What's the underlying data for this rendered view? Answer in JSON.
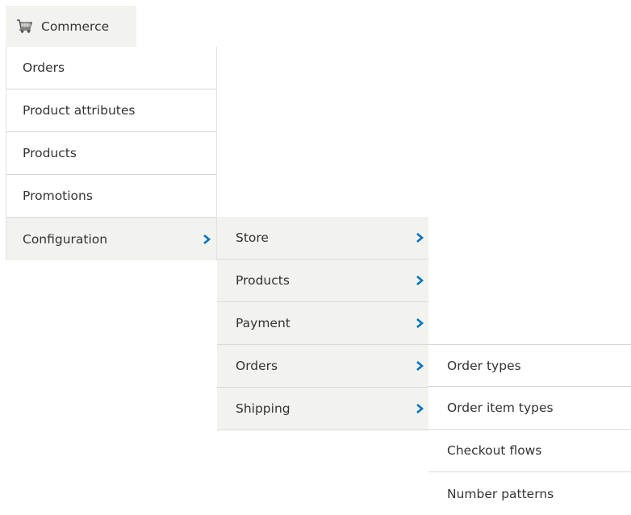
{
  "top_tab": {
    "icon": "shopping-cart-icon",
    "label": "Commerce"
  },
  "menu_level1": [
    {
      "label": "Orders"
    },
    {
      "label": "Product attributes"
    },
    {
      "label": "Products"
    },
    {
      "label": "Promotions"
    },
    {
      "label": "Configuration",
      "has_submenu": true,
      "active": true
    }
  ],
  "menu_level2": [
    {
      "label": "Store",
      "has_submenu": true
    },
    {
      "label": "Products",
      "has_submenu": true
    },
    {
      "label": "Payment",
      "has_submenu": true
    },
    {
      "label": "Orders",
      "has_submenu": true,
      "active": true
    },
    {
      "label": "Shipping",
      "has_submenu": true
    }
  ],
  "menu_level3": [
    {
      "label": "Order types"
    },
    {
      "label": "Order item types"
    },
    {
      "label": "Checkout flows"
    },
    {
      "label": "Number patterns"
    }
  ],
  "colors": {
    "chevron": "#0074bd",
    "menu_bg": "#f2f2ee",
    "divider": "#d8d8d8",
    "text": "#333333"
  }
}
